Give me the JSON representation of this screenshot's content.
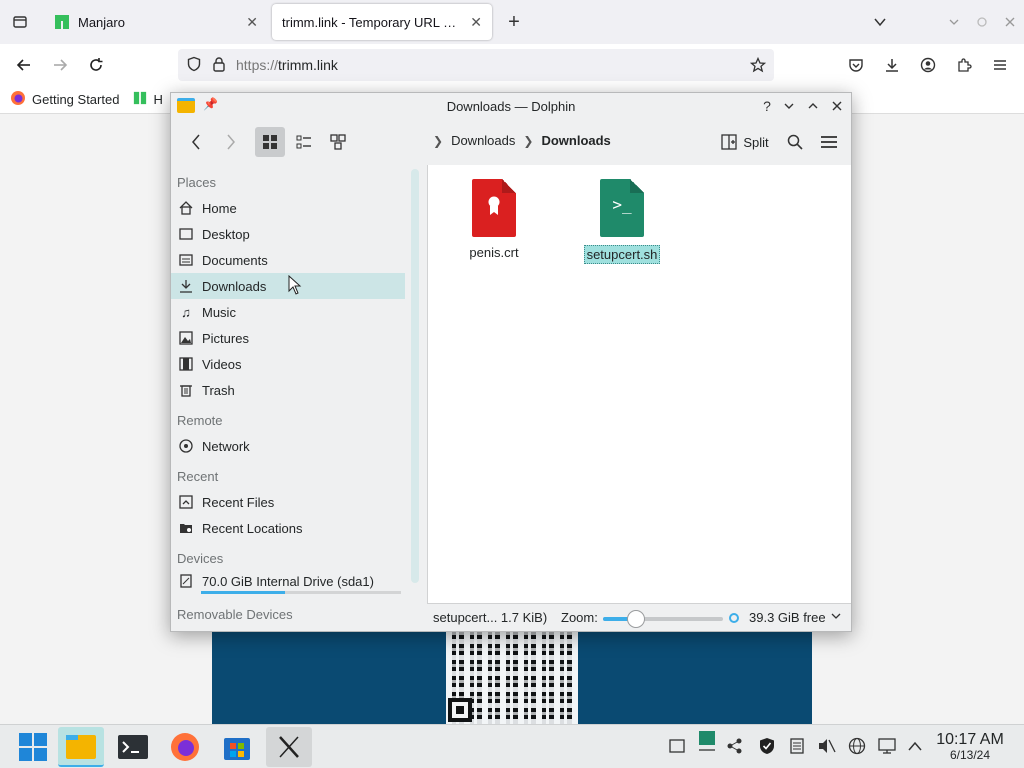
{
  "firefox": {
    "tabs": [
      {
        "title": "Manjaro",
        "close": "✕"
      },
      {
        "title": "trimm.link - Temporary URL shortener",
        "close": "✕"
      }
    ],
    "new_tab": "+",
    "url_scheme": "https://",
    "url_host": "trimm.link",
    "bookmarks": [
      {
        "label": "Getting Started"
      },
      {
        "label": "H"
      }
    ]
  },
  "dolphin": {
    "title": "Downloads — Dolphin",
    "breadcrumb": [
      "Downloads",
      "Downloads"
    ],
    "split_label": "Split",
    "places": {
      "places_header": "Places",
      "places_items": [
        "Home",
        "Desktop",
        "Documents",
        "Downloads",
        "Music",
        "Pictures",
        "Videos",
        "Trash"
      ],
      "remote_header": "Remote",
      "remote_items": [
        "Network"
      ],
      "recent_header": "Recent",
      "recent_items": [
        "Recent Files",
        "Recent Locations"
      ],
      "devices_header": "Devices",
      "devices_items": [
        "70.0 GiB Internal Drive (sda1)"
      ],
      "removable_header": "Removable Devices",
      "selected": "Downloads",
      "drive_usage_fraction": 0.42
    },
    "files": [
      {
        "name": "penis.crt",
        "type": "certificate",
        "color": "#da2020"
      },
      {
        "name": "setupcert.sh",
        "type": "shell-script",
        "color": "#1f8a6a",
        "selected": true
      }
    ],
    "status": {
      "selection": "setupcert... 1.7 KiB)",
      "zoom_label": "Zoom:",
      "zoom_fraction": 0.28,
      "free_space": "39.3 GiB free"
    }
  },
  "taskbar": {
    "time": "10:17 AM",
    "date": "6/13/24"
  },
  "colors": {
    "accent": "#3daee9",
    "selection": "#cce5e6",
    "crt_icon": "#da2020",
    "sh_icon": "#1f8a6a"
  }
}
